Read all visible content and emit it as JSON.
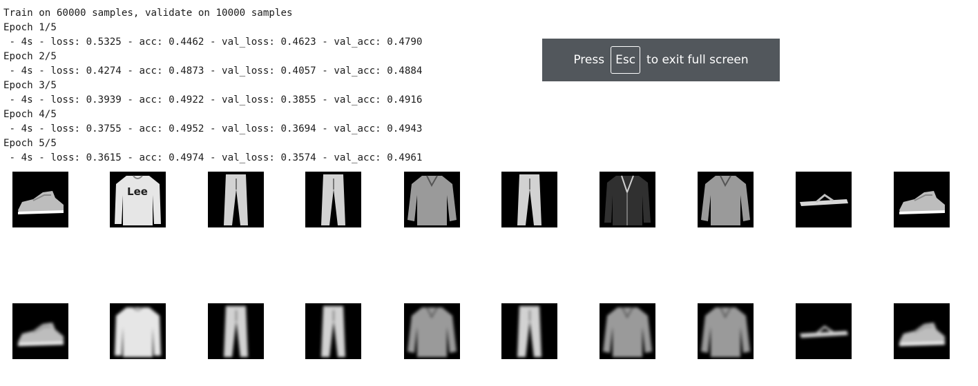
{
  "console": {
    "lines": [
      "Train on 60000 samples, validate on 10000 samples",
      "Epoch 1/5",
      " - 4s - loss: 0.5325 - acc: 0.4462 - val_loss: 0.4623 - val_acc: 0.4790",
      "Epoch 2/5",
      " - 4s - loss: 0.4274 - acc: 0.4873 - val_loss: 0.4057 - val_acc: 0.4884",
      "Epoch 3/5",
      " - 4s - loss: 0.3939 - acc: 0.4922 - val_loss: 0.3855 - val_acc: 0.4916",
      "Epoch 4/5",
      " - 4s - loss: 0.3755 - acc: 0.4952 - val_loss: 0.3694 - val_acc: 0.4943",
      "Epoch 5/5",
      " - 4s - loss: 0.3615 - acc: 0.4974 - val_loss: 0.3574 - val_acc: 0.4961"
    ]
  },
  "fullscreen_notice": {
    "press": "Press",
    "key": "Esc",
    "rest": "to exit full screen"
  },
  "images": {
    "originals": [
      {
        "item": "sneaker-icon",
        "logo": ""
      },
      {
        "item": "sweater-icon",
        "logo": "Lee"
      },
      {
        "item": "trousers-icon",
        "logo": ""
      },
      {
        "item": "trousers-icon",
        "logo": ""
      },
      {
        "item": "shirt-icon",
        "logo": ""
      },
      {
        "item": "trousers-icon",
        "logo": ""
      },
      {
        "item": "coat-icon",
        "logo": ""
      },
      {
        "item": "shirt-icon",
        "logo": ""
      },
      {
        "item": "sandal-icon",
        "logo": ""
      },
      {
        "item": "sneaker-icon",
        "logo": ""
      }
    ],
    "reconstructions": [
      {
        "item": "sneaker-icon"
      },
      {
        "item": "sweater-icon"
      },
      {
        "item": "trousers-icon"
      },
      {
        "item": "trousers-icon"
      },
      {
        "item": "shirt-icon"
      },
      {
        "item": "trousers-icon"
      },
      {
        "item": "shirt-icon"
      },
      {
        "item": "shirt-icon"
      },
      {
        "item": "sandal-icon"
      },
      {
        "item": "sneaker-icon"
      }
    ]
  }
}
